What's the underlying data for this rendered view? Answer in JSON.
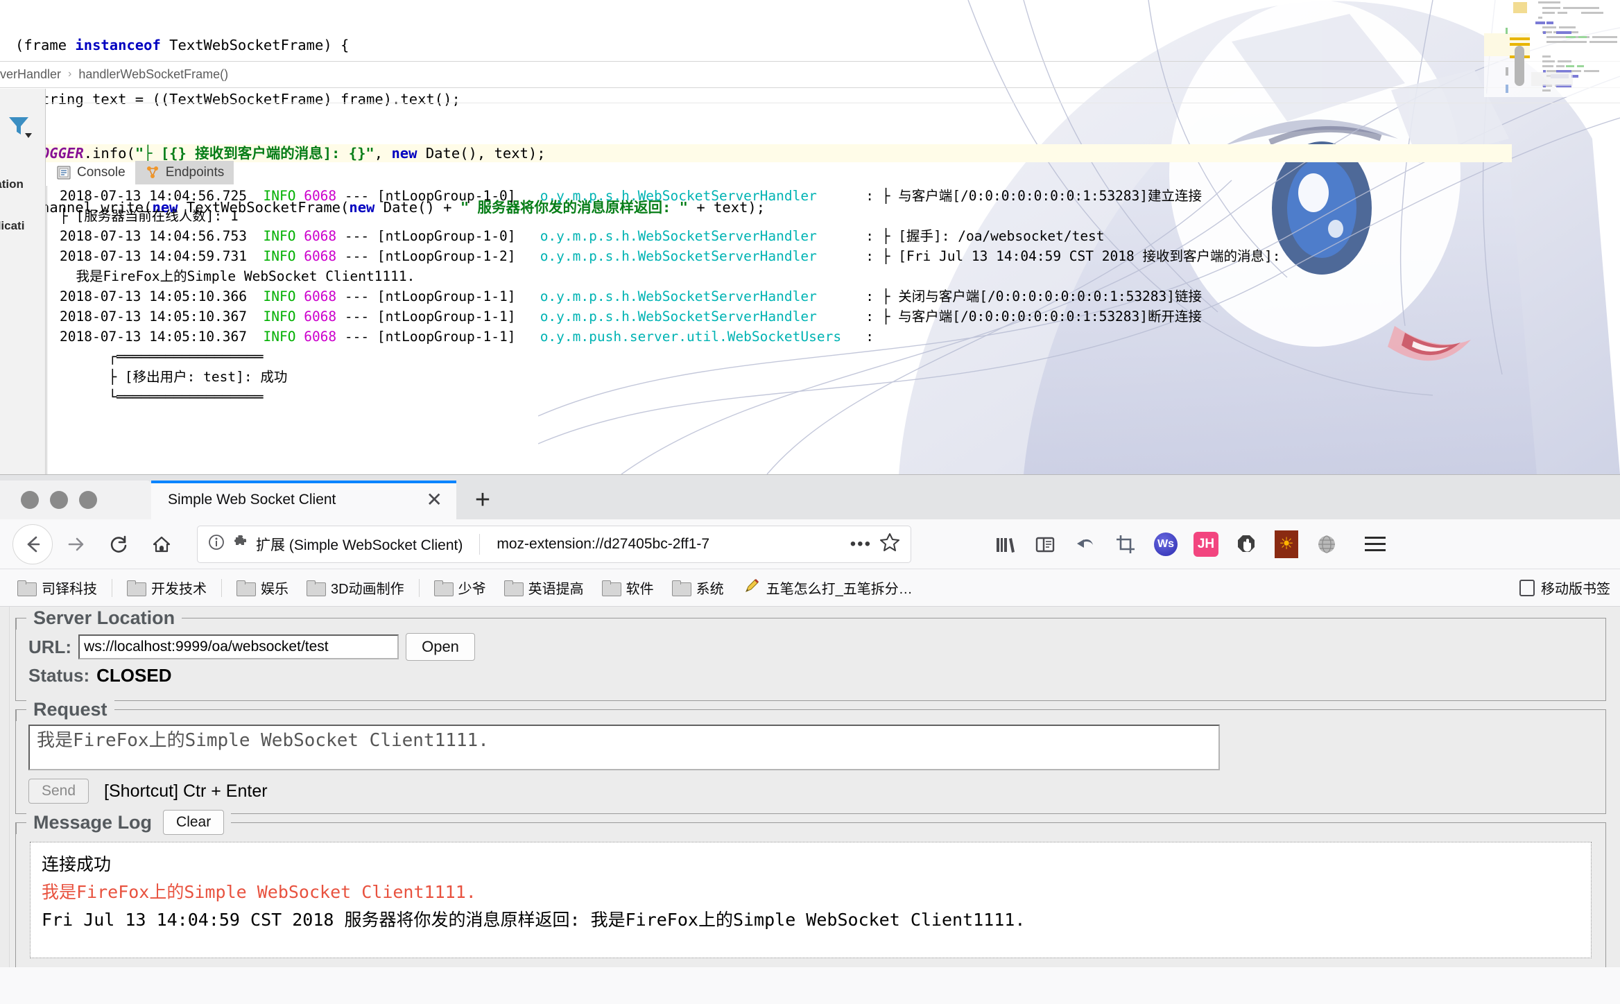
{
  "ide": {
    "code_lines": [
      [
        {
          "t": "(frame ",
          "c": "plain"
        },
        {
          "t": "instanceof",
          "c": "kw"
        },
        {
          "t": " TextWebSocketFrame) {",
          "c": "plain"
        }
      ],
      [
        {
          "t": "  String text = ((TextWebSocketFrame) frame).text();",
          "c": "plain"
        }
      ],
      [
        {
          "t": "  ",
          "c": "plain"
        },
        {
          "t": "LOGGER",
          "c": "field"
        },
        {
          "t": ".info(",
          "c": "plain"
        },
        {
          "t": "\"├ [{} 接收到客户端的消息]: {}\"",
          "c": "str"
        },
        {
          "t": ", ",
          "c": "plain"
        },
        {
          "t": "new",
          "c": "kw"
        },
        {
          "t": " Date(), text);",
          "c": "plain"
        }
      ],
      [
        {
          "t": "  channel.write(",
          "c": "plain"
        },
        {
          "t": "new",
          "c": "kw"
        },
        {
          "t": " TextWebSocketFrame(",
          "c": "plain"
        },
        {
          "t": "new",
          "c": "kw"
        },
        {
          "t": " Date() + ",
          "c": "plain"
        },
        {
          "t": "\" 服务器将你发的消息原样返回: \"",
          "c": "str"
        },
        {
          "t": " + text);",
          "c": "plain"
        }
      ]
    ],
    "highlight_line_index": 2,
    "breadcrumb": [
      "verHandler",
      "handlerWebSocketFrame()"
    ],
    "left_labels": [
      "plication",
      "tApplicati"
    ],
    "tabs": [
      {
        "label": "Console",
        "icon": "console-icon",
        "selected": false
      },
      {
        "label": "Endpoints",
        "icon": "endpoints-icon",
        "selected": true
      }
    ],
    "console_lines": [
      {
        "type": "log",
        "ts": "2018-07-13 14:04:56.725",
        "level": "INFO",
        "pid": "6068",
        "dash": "---",
        "thread": "[ntLoopGroup-1-0]",
        "cls": "o.y.m.p.s.h.WebSocketServerHandler",
        "sep": ":",
        "msg": "├ 与客户端[/0:0:0:0:0:0:0:1:53283]建立连接"
      },
      {
        "type": "cont",
        "text": "├ [服务器当前在线人数]: 1",
        "indent": 0
      },
      {
        "type": "log",
        "ts": "2018-07-13 14:04:56.753",
        "level": "INFO",
        "pid": "6068",
        "dash": "---",
        "thread": "[ntLoopGroup-1-0]",
        "cls": "o.y.m.p.s.h.WebSocketServerHandler",
        "sep": ":",
        "msg": "├ [握手]: /oa/websocket/test"
      },
      {
        "type": "log",
        "ts": "2018-07-13 14:04:59.731",
        "level": "INFO",
        "pid": "6068",
        "dash": "---",
        "thread": "[ntLoopGroup-1-2]",
        "cls": "o.y.m.p.s.h.WebSocketServerHandler",
        "sep": ":",
        "msg": "├ [Fri Jul 13 14:04:59 CST 2018 接收到客户端的消息]:"
      },
      {
        "type": "cont",
        "text": "  我是FireFox上的Simple WebSocket Client1111.",
        "indent": 0
      },
      {
        "type": "log",
        "ts": "2018-07-13 14:05:10.366",
        "level": "INFO",
        "pid": "6068",
        "dash": "---",
        "thread": "[ntLoopGroup-1-1]",
        "cls": "o.y.m.p.s.h.WebSocketServerHandler",
        "sep": ":",
        "msg": "├ 关闭与客户端[/0:0:0:0:0:0:0:1:53283]链接"
      },
      {
        "type": "log",
        "ts": "2018-07-13 14:05:10.367",
        "level": "INFO",
        "pid": "6068",
        "dash": "---",
        "thread": "[ntLoopGroup-1-1]",
        "cls": "o.y.m.p.s.h.WebSocketServerHandler",
        "sep": ":",
        "msg": "├ 与客户端[/0:0:0:0:0:0:0:1:53283]断开连接"
      },
      {
        "type": "log",
        "ts": "2018-07-13 14:05:10.367",
        "level": "INFO",
        "pid": "6068",
        "dash": "---",
        "thread": "[ntLoopGroup-1-1]",
        "cls": "o.y.m.push.server.util.WebSocketUsers",
        "sep": ":",
        "msg": ""
      },
      {
        "type": "cont",
        "text": "      ┌══════════════════",
        "indent": 0
      },
      {
        "type": "cont",
        "text": "      ├ [移出用户: test]: 成功",
        "indent": 0
      },
      {
        "type": "cont",
        "text": "      └══════════════════",
        "indent": 0
      }
    ]
  },
  "browser": {
    "tab": {
      "title": "Simple Web Socket Client",
      "close_label": "✕"
    },
    "new_tab_label": "+",
    "nav": {
      "back": "back-arrow",
      "forward": "forward-arrow",
      "reload": "reload",
      "home": "home"
    },
    "urlbar": {
      "identity_label": "扩展 (Simple WebSocket Client)",
      "url": "moz-extension://d27405bc-2ff1-7",
      "dots": "•••"
    },
    "toolbar_icons": [
      {
        "name": "library-icon",
        "label": ""
      },
      {
        "name": "sidebar-icon",
        "label": ""
      },
      {
        "name": "undo-icon",
        "label": ""
      },
      {
        "name": "screenshot-icon",
        "label": ""
      },
      {
        "name": "websocket-badge-icon",
        "label": "Ws"
      },
      {
        "name": "jh-badge-icon",
        "label": "JH"
      },
      {
        "name": "noscript-icon",
        "label": ""
      },
      {
        "name": "sun-badge-icon",
        "label": "☀"
      },
      {
        "name": "globe-icon",
        "label": ""
      }
    ],
    "bookmarks": [
      {
        "label": "司铎科技",
        "icon": "folder-icon",
        "sep_after": true
      },
      {
        "label": "开发技术",
        "icon": "folder-icon",
        "sep_after": true
      },
      {
        "label": "娱乐",
        "icon": "folder-icon",
        "sep_after": false
      },
      {
        "label": "3D动画制作",
        "icon": "folder-icon",
        "sep_after": true
      },
      {
        "label": "少爷",
        "icon": "folder-icon",
        "sep_after": false
      },
      {
        "label": "英语提高",
        "icon": "folder-icon",
        "sep_after": false
      },
      {
        "label": "软件",
        "icon": "folder-icon",
        "sep_after": false
      },
      {
        "label": "系统",
        "icon": "folder-icon",
        "sep_after": false
      },
      {
        "label": "五笔怎么打_五笔拆分…",
        "icon": "pencil-icon",
        "sep_after": false
      }
    ],
    "bookmarks_right_label": "移动版书签"
  },
  "app": {
    "server_location": {
      "legend": "Server Location",
      "url_label": "URL:",
      "url_value": "ws://localhost:9999/oa/websocket/test",
      "url_placeholder": "ws://",
      "open_label": "Open",
      "status_label": "Status:",
      "status_value": "CLOSED"
    },
    "request": {
      "legend": "Request",
      "text_value": "我是FireFox上的Simple WebSocket Client1111.",
      "text_placeholder": "",
      "send_label": "Send",
      "shortcut_label": "[Shortcut] Ctr + Enter"
    },
    "message_log": {
      "legend": "Message Log",
      "clear_label": "Clear",
      "entries": [
        {
          "kind": "status",
          "text": "连接成功"
        },
        {
          "kind": "outgoing",
          "text": "我是FireFox上的Simple WebSocket Client1111."
        },
        {
          "kind": "incoming",
          "text": "Fri Jul 13 14:04:59 CST 2018 服务器将你发的消息原样返回: 我是FireFox上的Simple WebSocket Client1111."
        }
      ]
    }
  },
  "colors": {
    "accent_blue": "#0a84ff",
    "log_info_green": "#00b000",
    "log_pid_magenta": "#cc00cc",
    "log_class_cyan": "#00b3b3",
    "outgoing_red": "#e8523f",
    "legend_grey": "#555a5e"
  }
}
